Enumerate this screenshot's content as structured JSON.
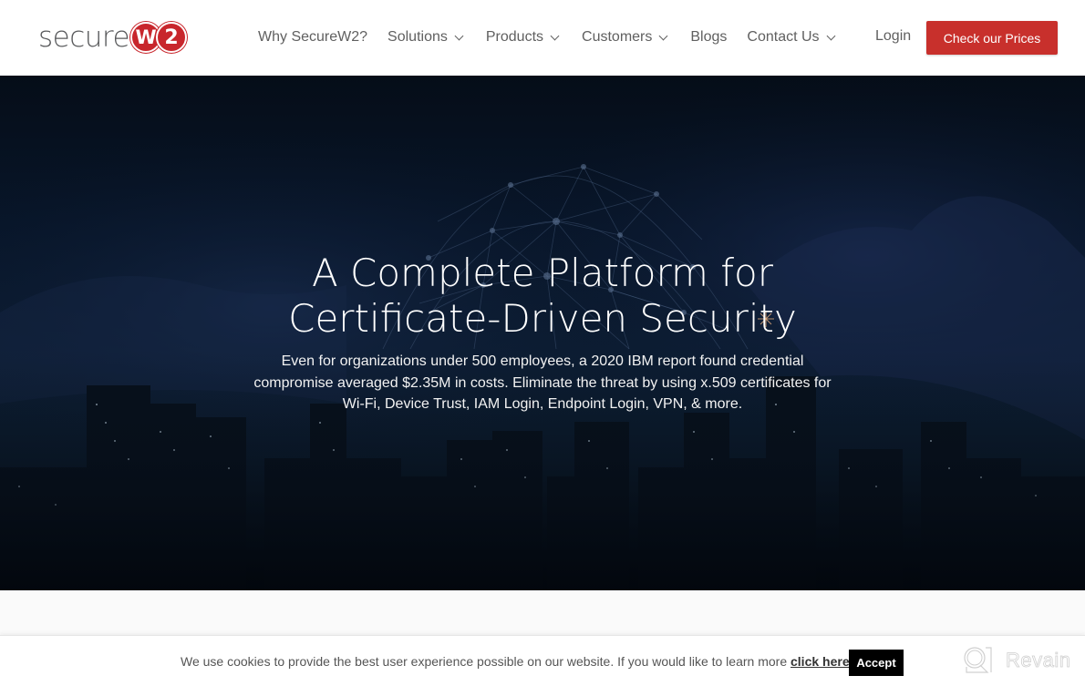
{
  "header": {
    "logo": {
      "text": "secure",
      "badge_1": "W",
      "badge_2": "2",
      "alt": "SecureW2"
    },
    "nav": [
      {
        "label": "Why SecureW2?",
        "has_dropdown": false
      },
      {
        "label": "Solutions",
        "has_dropdown": true
      },
      {
        "label": "Products",
        "has_dropdown": true
      },
      {
        "label": "Customers",
        "has_dropdown": true
      },
      {
        "label": "Blogs",
        "has_dropdown": false
      },
      {
        "label": "Contact Us",
        "has_dropdown": true
      }
    ],
    "login_label": "Login",
    "cta_label": "Check our Prices"
  },
  "hero": {
    "title_line_1": "A Complete Platform for",
    "title_line_2": "Certificate-Driven Security",
    "subtitle": "Even for organizations under 500 employees, a 2020 IBM report found credential compromise averaged $2.35M in costs. Eliminate the threat by using x.509 certificates for Wi-Fi, Device Trust, IAM Login, Endpoint Login, VPN, & more."
  },
  "cookie_bar": {
    "text": "We use cookies to provide the best user experience possible on our website. If you would like to learn more ",
    "link_label": "click here",
    "after_link": ".",
    "accept_label": "Accept"
  },
  "watermark": {
    "label": "Revain"
  },
  "colors": {
    "brand_red": "#c8262c",
    "cta_red": "#c8302c",
    "nav_text": "#606060",
    "hero_bg": "#0b1a2b",
    "accept_bg": "#000000"
  }
}
